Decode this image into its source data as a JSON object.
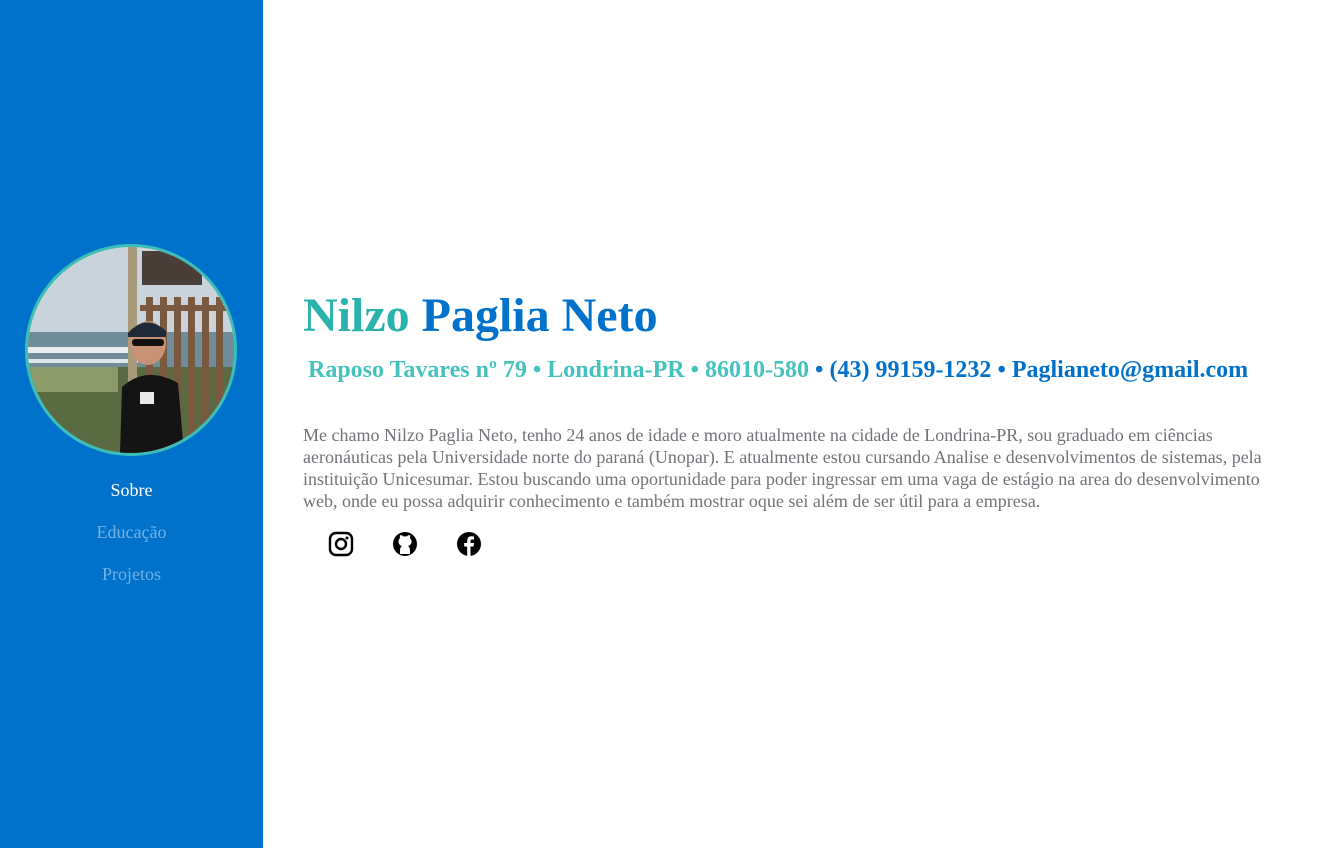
{
  "profile": {
    "photo_alt": "Foto de perfil"
  },
  "nav": {
    "items": [
      {
        "label": "Sobre",
        "active": true
      },
      {
        "label": "Educação",
        "active": false
      },
      {
        "label": "Projetos",
        "active": false
      }
    ]
  },
  "header": {
    "name_first": "Nilzo",
    "name_rest": "Paglia Neto",
    "address": "Raposo Tavares nº 79",
    "city": "Londrina-PR",
    "zip": "86010-580",
    "phone": "(43) 99159-1232",
    "email": "Paglianeto@gmail.com",
    "separator": "•"
  },
  "about": {
    "text": "Me chamo Nilzo Paglia Neto, tenho 24 anos de idade e moro atualmente na cidade de Londrina-PR, sou graduado em ciências aeronáuticas pela Universidade norte do paraná (Unopar). E atualmente estou cursando Analise e desenvolvimentos de sistemas, pela instituição Unicesumar. Estou buscando uma oportunidade para poder ingressar em uma vaga de estágio na area do desenvolvimento web, onde eu possa adquirir conhecimento e também mostrar oque sei além de ser útil para a empresa."
  },
  "social": {
    "icons": [
      "instagram-icon",
      "github-icon",
      "facebook-icon"
    ]
  },
  "colors": {
    "sidebar": "#0172cb",
    "accent_teal": "#29b3ac",
    "accent_blue": "#0172cb",
    "body_text": "#707378"
  }
}
